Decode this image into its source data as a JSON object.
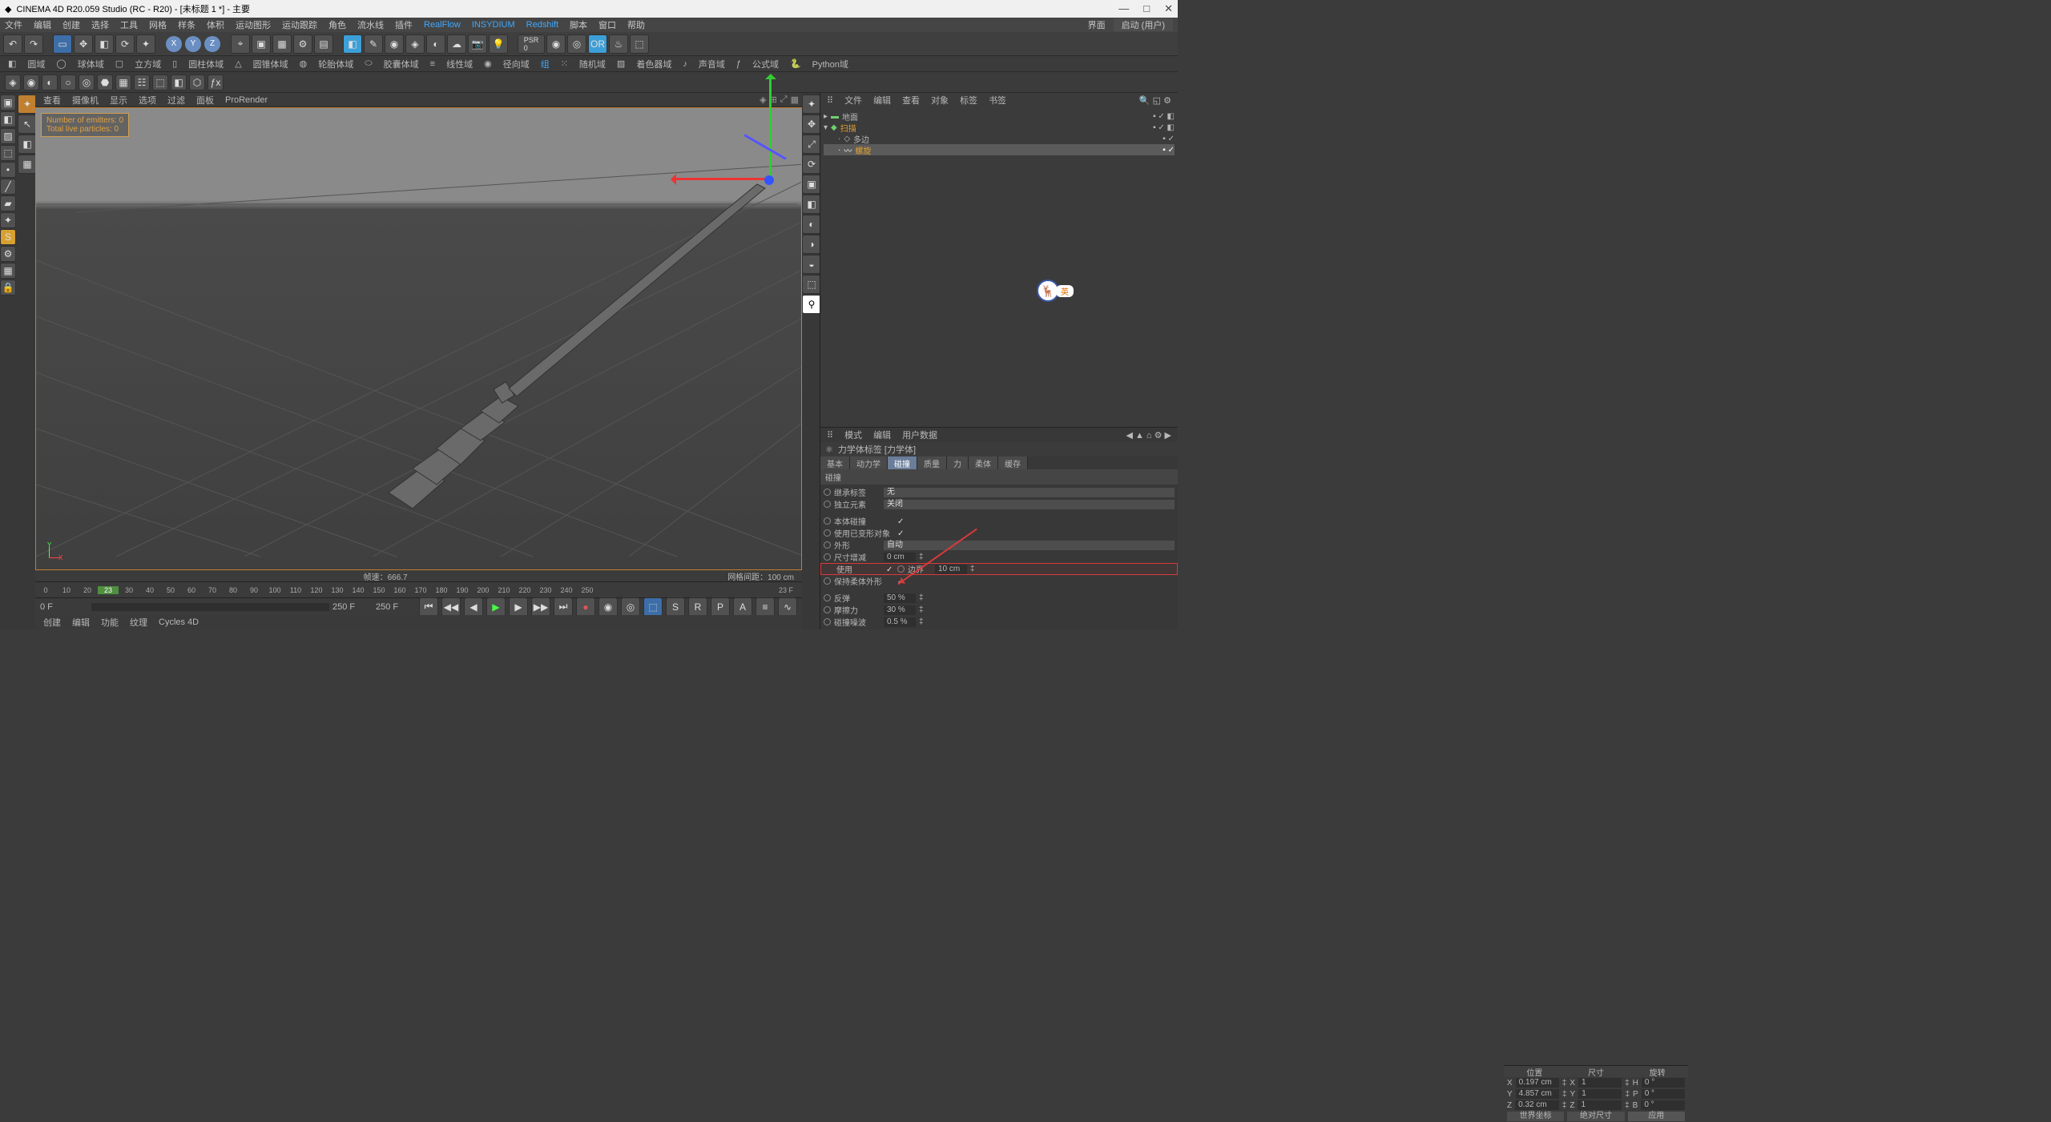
{
  "title": "CINEMA 4D R20.059 Studio (RC - R20) - [未标题 1 *] - 主要",
  "menubar": [
    "文件",
    "编辑",
    "创建",
    "选择",
    "工具",
    "网格",
    "样条",
    "体积",
    "运动图形",
    "运动跟踪",
    "角色",
    "流水线",
    "插件",
    "RealFlow",
    "INSYDIUM",
    "Redshift",
    "脚本",
    "窗口",
    "帮助"
  ],
  "menubar_right_label": "界面",
  "menubar_right_value": "启动 (用户)",
  "subbar": [
    "圆域",
    "球体域",
    "立方域",
    "圆柱体域",
    "圆锥体域",
    "轮胎体域",
    "胶囊体域",
    "线性域",
    "径向域",
    "组",
    "随机域",
    "着色器域",
    "声音域",
    "公式域",
    "Python域"
  ],
  "vptabs": [
    "查看",
    "摄像机",
    "显示",
    "选项",
    "过滤",
    "面板",
    "ProRender"
  ],
  "vp_overlay": {
    "l1": "Number of emitters: 0",
    "l2": "Total live particles: 0"
  },
  "vp_footer_left": "帧速：666.7",
  "vp_footer_right": "网格间距：100 cm",
  "timeline_nums": [
    "0",
    "10",
    "20",
    "23",
    "30",
    "40",
    "50",
    "60",
    "70",
    "80",
    "90",
    "100",
    "110",
    "120",
    "130",
    "140",
    "150",
    "160",
    "170",
    "180",
    "190",
    "200",
    "210",
    "220",
    "230",
    "240",
    "250"
  ],
  "timeline_end": "23 F",
  "playbar_left": "0 F",
  "playbar_mid": "250 F",
  "playbar_right": "250 F",
  "statusrow": [
    "创建",
    "编辑",
    "功能",
    "纹理",
    "Cycles 4D"
  ],
  "coord": {
    "hdr": [
      "位置",
      "尺寸",
      "旋转"
    ],
    "rows": [
      {
        "ax": "X",
        "pos": "0.197 cm",
        "sz": "1",
        "rot": "0 °",
        "szp": "X",
        "rotp": "H"
      },
      {
        "ax": "Y",
        "pos": "4.857 cm",
        "sz": "1",
        "rot": "0 °",
        "szp": "Y",
        "rotp": "P"
      },
      {
        "ax": "Z",
        "pos": "0.32 cm",
        "sz": "1",
        "rot": "0 °",
        "szp": "Z",
        "rotp": "B"
      }
    ],
    "sel1": "世界坐标",
    "sel2": "绝对尺寸",
    "btn": "应用"
  },
  "right_tabs": [
    "文件",
    "编辑",
    "查看",
    "对象",
    "标签",
    "书签"
  ],
  "hierarchy": [
    {
      "name": "地面",
      "depth": 0,
      "color": "#6fcf6f"
    },
    {
      "name": "扫描",
      "depth": 0,
      "color": "#e0a030",
      "active": true
    },
    {
      "name": "多边",
      "depth": 1,
      "color": "#bbb"
    },
    {
      "name": "螺旋",
      "depth": 1,
      "color": "#e0a030"
    }
  ],
  "attr_tabs": [
    "模式",
    "编辑",
    "用户数据"
  ],
  "attr_title": "力学体标签 [力学体]",
  "atabs": [
    "基本",
    "动力学",
    "碰撞",
    "质量",
    "力",
    "柔体",
    "缓存"
  ],
  "section": "碰撞",
  "rows": {
    "inherit": "继承标签",
    "inherit_v": "无",
    "indep": "独立元素",
    "indep_v": "关闭",
    "selfcol": "本体碰撞",
    "deform": "使用已变形对象",
    "shape": "外形",
    "shape_v": "自动",
    "sizeinc": "尺寸增减",
    "sizeinc_v": "0 cm",
    "use": "使用",
    "margin": "边界",
    "margin_v": "10 cm",
    "keep": "保持柔体外形",
    "bounce": "反弹",
    "bounce_v": "50 %",
    "friction": "摩擦力",
    "friction_v": "30 %",
    "coldamp": "碰撞噪波",
    "coldamp_v": "0.5 %"
  },
  "badge": "英"
}
